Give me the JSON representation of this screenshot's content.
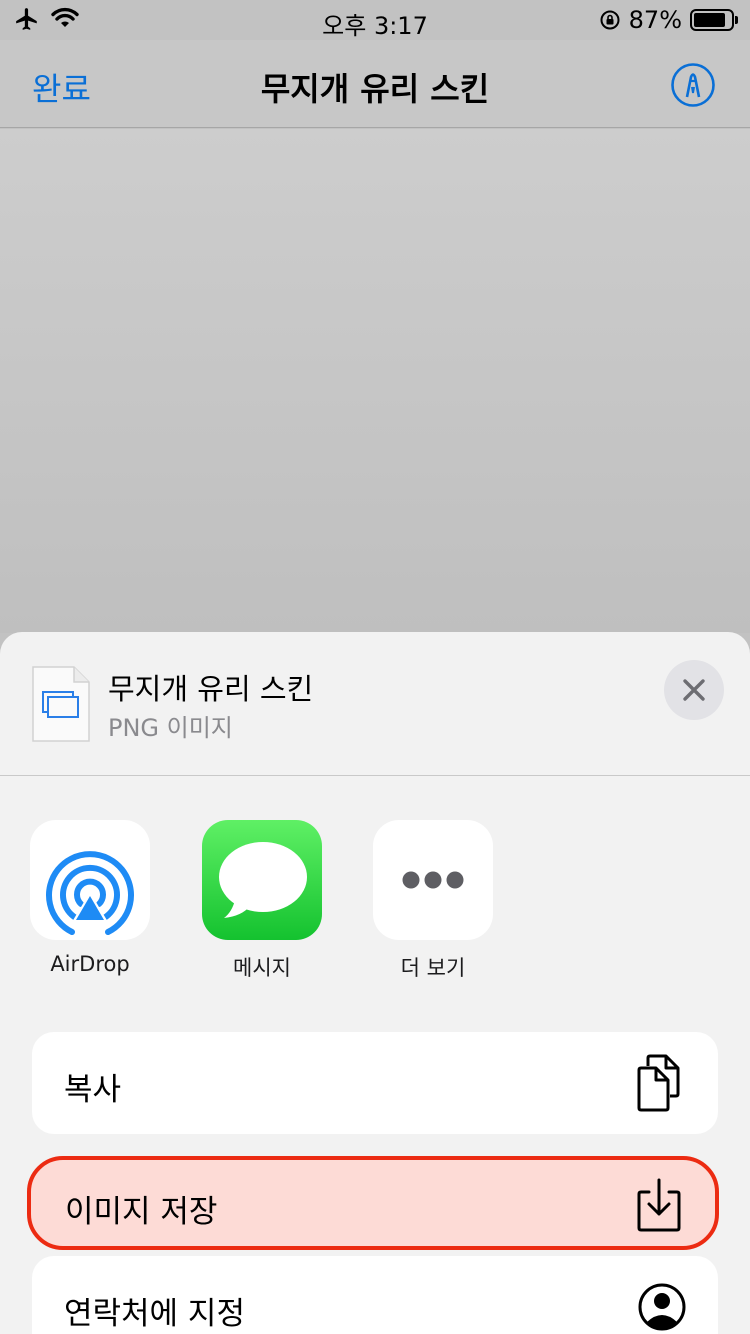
{
  "status_bar": {
    "time": "오후 3:17",
    "battery_percent_text": "87%",
    "battery_level": 0.87,
    "icons": [
      "airplane-icon",
      "wifi-icon",
      "orientation-lock-icon",
      "battery-icon"
    ]
  },
  "nav": {
    "done_label": "완료",
    "title": "무지개 유리 스킨",
    "accent_color": "#0a6fd6",
    "right_icon": "markup-icon"
  },
  "sheet": {
    "file_title": "무지개 유리 스킨",
    "file_subtitle": "PNG 이미지",
    "close_icon": "close-icon",
    "apps": [
      {
        "label": "AirDrop",
        "icon": "airdrop-icon"
      },
      {
        "label": "메시지",
        "icon": "messages-icon"
      },
      {
        "label": "더 보기",
        "icon": "more-icon"
      }
    ],
    "actions": [
      {
        "label": "복사",
        "icon": "copy-icon"
      },
      {
        "label": "이미지 저장",
        "icon": "save-image-icon",
        "highlight_color": "#ec2b12"
      },
      {
        "label": "연락처에 지정",
        "icon": "contact-icon"
      }
    ]
  }
}
